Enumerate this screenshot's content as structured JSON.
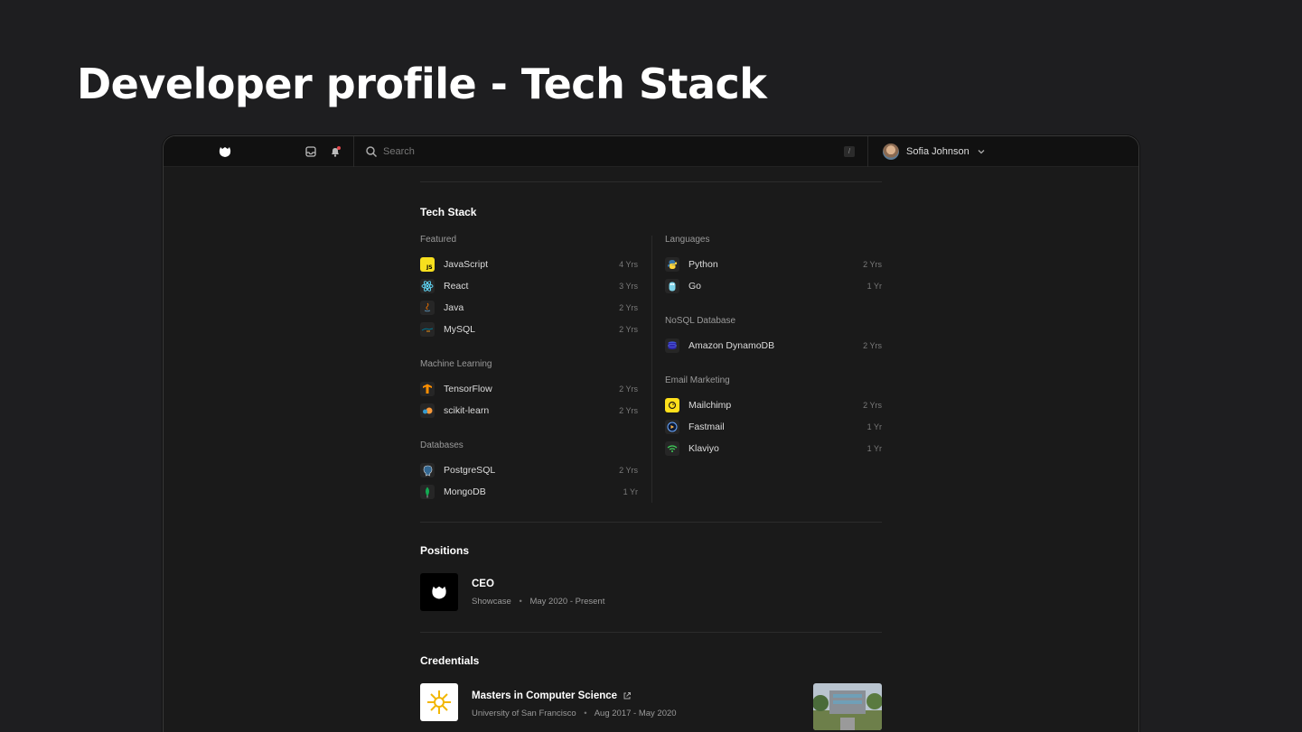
{
  "slide": {
    "title": "Developer profile - Tech Stack"
  },
  "topbar": {
    "search_placeholder": "Search",
    "search_shortcut": "/",
    "user_name": "Sofia Johnson"
  },
  "tech_stack": {
    "title": "Tech Stack",
    "left": [
      {
        "label": "Featured",
        "items": [
          {
            "name": "JavaScript",
            "years": "4 Yrs",
            "icon": "javascript-icon"
          },
          {
            "name": "React",
            "years": "3 Yrs",
            "icon": "react-icon"
          },
          {
            "name": "Java",
            "years": "2 Yrs",
            "icon": "java-icon"
          },
          {
            "name": "MySQL",
            "years": "2 Yrs",
            "icon": "mysql-icon"
          }
        ]
      },
      {
        "label": "Machine Learning",
        "items": [
          {
            "name": "TensorFlow",
            "years": "2 Yrs",
            "icon": "tensorflow-icon"
          },
          {
            "name": "scikit-learn",
            "years": "2 Yrs",
            "icon": "scikit-learn-icon"
          }
        ]
      },
      {
        "label": "Databases",
        "items": [
          {
            "name": "PostgreSQL",
            "years": "2 Yrs",
            "icon": "postgresql-icon"
          },
          {
            "name": "MongoDB",
            "years": "1 Yr",
            "icon": "mongodb-icon"
          }
        ]
      }
    ],
    "right": [
      {
        "label": "Languages",
        "items": [
          {
            "name": "Python",
            "years": "2 Yrs",
            "icon": "python-icon"
          },
          {
            "name": "Go",
            "years": "1 Yr",
            "icon": "go-icon"
          }
        ]
      },
      {
        "label": "NoSQL Database",
        "items": [
          {
            "name": "Amazon DynamoDB",
            "years": "2 Yrs",
            "icon": "dynamodb-icon"
          }
        ]
      },
      {
        "label": "Email Marketing",
        "items": [
          {
            "name": "Mailchimp",
            "years": "2 Yrs",
            "icon": "mailchimp-icon"
          },
          {
            "name": "Fastmail",
            "years": "1 Yr",
            "icon": "fastmail-icon"
          },
          {
            "name": "Klaviyo",
            "years": "1 Yr",
            "icon": "klaviyo-icon"
          }
        ]
      }
    ]
  },
  "positions": {
    "title": "Positions",
    "items": [
      {
        "role": "CEO",
        "company": "Showcase",
        "dates": "May 2020 - Present"
      }
    ]
  },
  "credentials": {
    "title": "Credentials",
    "items": [
      {
        "name": "Masters in Computer Science",
        "school": "University of San Francisco",
        "dates": "Aug 2017 - May 2020"
      }
    ]
  }
}
